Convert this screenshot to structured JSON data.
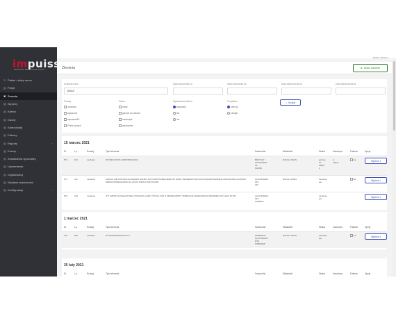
{
  "app": {
    "logo_im": "im",
    "logo_puiss": "puiss",
    "logo_sub": "CENTRUM SERWISOWE PUISS",
    "user": "RAFAL JANAS"
  },
  "sidebar": {
    "items": [
      {
        "icon": "⊙",
        "label": "Pakiet / sklep meno",
        "active": false,
        "chevron": false
      },
      {
        "icon": "▤",
        "label": "Pulpit",
        "active": false,
        "chevron": false
      },
      {
        "icon": "✖",
        "label": "Zecenia",
        "active": true,
        "chevron": false
      },
      {
        "icon": "▤",
        "label": "Wyceny",
        "active": false,
        "chevron": false
      },
      {
        "icon": "▤",
        "label": "Klienci",
        "active": false,
        "chevron": false
      },
      {
        "icon": "▤",
        "label": "Osoby",
        "active": false,
        "chevron": false
      },
      {
        "icon": "▤",
        "label": "Samochody",
        "active": false,
        "chevron": false
      },
      {
        "icon": "▤",
        "label": "Faktury",
        "active": false,
        "chevron": false
      },
      {
        "icon": "▤",
        "label": "Raporty",
        "active": false,
        "chevron": true
      },
      {
        "icon": "▤",
        "label": "Koszty",
        "active": false,
        "chevron": false
      },
      {
        "icon": "▤",
        "label": "Zestawienia sprzedaży",
        "active": false,
        "chevron": false
      },
      {
        "icon": "▤",
        "label": "Uprawnienia",
        "active": false,
        "chevron": false
      },
      {
        "icon": "▤",
        "label": "Użytkownicy",
        "active": false,
        "chevron": false
      },
      {
        "icon": "▤",
        "label": "Wysłane wiadomości",
        "active": false,
        "chevron": false
      },
      {
        "icon": "▤",
        "label": "Konfiguracja",
        "active": false,
        "chevron": true
      }
    ]
  },
  "page": {
    "title": "Zlecenia",
    "new_button": "Nowe zlecenie"
  },
  "filters": {
    "search_label": "Szukana fraza",
    "search_value": "JANAS",
    "date_from_label": "Data utworzenia od",
    "date_to_label": "Data utworzenia do",
    "done_from_label": "Data zakończenia od",
    "done_to_label": "Data zakończenia do",
    "type_label": "Rodzaj",
    "type_options": [
      "osobowe",
      "ciężarowe",
      "naprawa B/L",
      "Pobór danych"
    ],
    "status_label": "Status",
    "status_options": [
      "nowe",
      "gotowe do odbioru",
      "zamknięte",
      "anulowane"
    ],
    "invoice_label": "Wystawiona faktura",
    "invoice_options": [
      "wszystkie",
      "tak",
      "nie"
    ],
    "paid_label": "Podpisane",
    "paid_options": [
      "obecny",
      "zaległe"
    ],
    "search_button": "Szukaj"
  },
  "columns": [
    "ID",
    "Lp",
    "Rodzaj",
    "Tytuł zlecenia",
    "Samochód",
    "Właściciel",
    "Status",
    "Kasztorys",
    "Faktura",
    "Opcje"
  ],
  "days": [
    {
      "date": "15 marzec 2021",
      "rows": [
        {
          "id": "573",
          "lp": "312",
          "type": "osobowe",
          "title": "WYCIEK PŁYNU WSPOMAGANIA",
          "car": "BENTLEY\nCONTINENT\nAL\nKAASA",
          "owner": "RAFAŁ JANAS",
          "status": "gotowe\ndo\nodbior\nu",
          "estimate": "w\ntrakcie",
          "invoice": "nie",
          "options": "Wybierz",
          "shaded": true
        },
        {
          "id": "571",
          "lp": "311",
          "type": "osobowe",
          "title": "ZAPALA SIĘ KONTROLKA AWARIA SILNIKA NA KOMPUTERZE BŁĄD ZA NISKA TEMPERATURA NA KATALIZATORZE/ZLE WSKAZANIA ŁĄCZNIKA ZEWN/I PRZEŁĄCZNIKI W~20 KM ZAPALA SIĘ ZNOWU",
          "car": "ALFA ROMEO\n159\n333",
          "owner": "RAFAŁ JANAS",
          "status": "zamknię\nęte",
          "estimate": "",
          "invoice": "tak",
          "options": "Wybierz",
          "shaded": false
        },
        {
          "id": "570",
          "lp": "310",
          "type": "osobowe",
          "title": "OTI CZĘŚCI W MAGAZYNIE I PODCZAS JAZDY STUKA COŚ Z PRZODU/PRZY SKRĘCANIU KIEROWNICĄ ROWNIEŻ SKYCHAC STUKI",
          "car": "ALFA ROMEO\n159\nWW4903",
          "owner": "",
          "status": "zamknię\nęte",
          "estimate": "",
          "invoice": "",
          "options": "Wybierz",
          "shaded": false
        }
      ]
    },
    {
      "date": "1 marzec 2021",
      "rows": [
        {
          "id": "470",
          "lp": "200",
          "type": "osobowe",
          "title": "DŹ WYMIAŻONE ROLO ?",
          "car": "MASERATI\nQUATTROPO\nRTE\nWPI0ZS45",
          "owner": "RAFAŁ JANAS",
          "status": "zamknię\nęte",
          "estimate": "",
          "invoice": "nie",
          "options": "Wybierz",
          "shaded": true
        }
      ]
    },
    {
      "date": "25 luty 2021",
      "rows": []
    }
  ],
  "colors": {
    "sidebar": "#2f3136",
    "accent_green": "#2e7d32",
    "accent_blue": "#3f51b5",
    "brand_red": "#c8102e"
  }
}
